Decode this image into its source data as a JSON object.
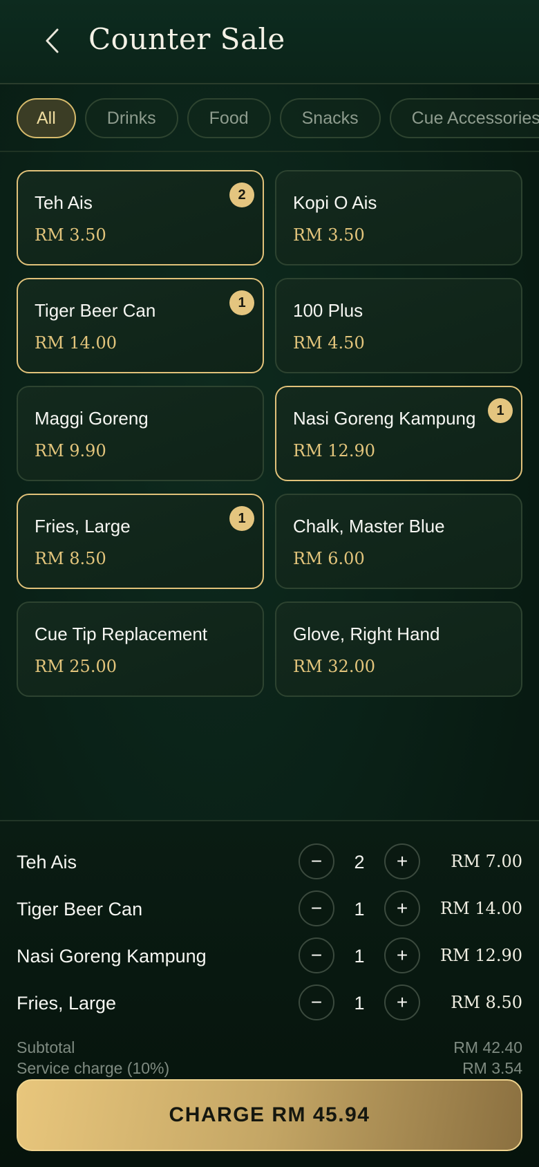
{
  "header": {
    "title": "Counter Sale",
    "back_icon": "chevron-left-icon"
  },
  "tabs": [
    {
      "label": "All",
      "active": true
    },
    {
      "label": "Drinks",
      "active": false
    },
    {
      "label": "Food",
      "active": false
    },
    {
      "label": "Snacks",
      "active": false
    },
    {
      "label": "Cue Accessories",
      "active": false
    }
  ],
  "products": [
    {
      "name": "Teh Ais",
      "price": "RM 3.50",
      "qty": "2",
      "selected": true
    },
    {
      "name": "Kopi O Ais",
      "price": "RM 3.50",
      "qty": "",
      "selected": false
    },
    {
      "name": "Tiger Beer Can",
      "price": "RM 14.00",
      "qty": "1",
      "selected": true
    },
    {
      "name": "100 Plus",
      "price": "RM 4.50",
      "qty": "",
      "selected": false
    },
    {
      "name": "Maggi Goreng",
      "price": "RM 9.90",
      "qty": "",
      "selected": false
    },
    {
      "name": "Nasi Goreng Kampung",
      "price": "RM 12.90",
      "qty": "1",
      "selected": true
    },
    {
      "name": "Fries, Large",
      "price": "RM 8.50",
      "qty": "1",
      "selected": true
    },
    {
      "name": "Chalk, Master Blue",
      "price": "RM 6.00",
      "qty": "",
      "selected": false
    },
    {
      "name": "Cue Tip Replacement",
      "price": "RM 25.00",
      "qty": "",
      "selected": false
    },
    {
      "name": "Glove, Right Hand",
      "price": "RM 32.00",
      "qty": "",
      "selected": false
    }
  ],
  "cart": {
    "items": [
      {
        "name": "Teh Ais",
        "qty": "2",
        "total": "RM 7.00"
      },
      {
        "name": "Tiger Beer Can",
        "qty": "1",
        "total": "RM 14.00"
      },
      {
        "name": "Nasi Goreng Kampung",
        "qty": "1",
        "total": "RM 12.90"
      },
      {
        "name": "Fries, Large",
        "qty": "1",
        "total": "RM 8.50"
      }
    ],
    "minus_label": "−",
    "plus_label": "+",
    "subtotal_label": "Subtotal",
    "subtotal_value": "RM 42.40",
    "service_label": "Service charge (10%)",
    "service_value": "RM 3.54",
    "charge_label": "CHARGE RM 45.94"
  },
  "colors": {
    "gold": "#e4c57f",
    "background": "#0a2117"
  }
}
